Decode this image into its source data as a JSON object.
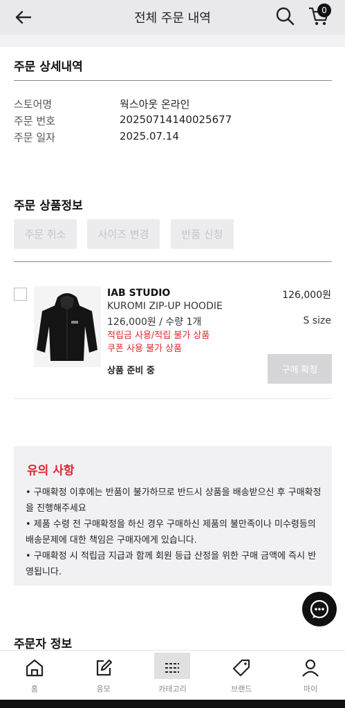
{
  "header": {
    "title": "전체 주문 내역",
    "cart_count": "0"
  },
  "order_detail": {
    "section_title": "주문 상세내역",
    "rows": [
      {
        "label": "스토어명",
        "value": "웍스아웃 온라인"
      },
      {
        "label": "주문 번호",
        "value": "20250714140025677"
      },
      {
        "label": "주문 일자",
        "value": "2025.07.14"
      }
    ]
  },
  "product_info": {
    "section_title": "주문 상품정보",
    "buttons": [
      "주문 취소",
      "사이즈 변경",
      "반품 신청"
    ],
    "item": {
      "brand": "IAB STUDIO",
      "name": "KUROMI ZIP-UP HOODIE",
      "price_qty": "126,000원 / 수량 1개",
      "note1": "적립금 사용/적립 불가 상품",
      "note2": "쿠폰 사용 불가 상품",
      "status": "상품 준비 중",
      "price": "126,000원",
      "size": "S size",
      "confirm_label": "구매 확정"
    }
  },
  "notice": {
    "title": "유의 사항",
    "items": [
      "• 구매확정 이후에는 반품이 불가하므로 반드시 상품을 배송받으신 후 구매확정을 진행해주세요",
      "• 제품 수령 전 구매확정을 하신 경우 구매하신 제품의 불만족이나 미수령등의 배송문제에 대한 책임은 구매자에게 있습니다.",
      "• 구매확정 시 적립금 지급과 함께 회원 등급 산정을 위한 구매 금액에 즉시 반영됩니다."
    ]
  },
  "orderer": {
    "section_title": "주문자 정보"
  },
  "bottom_nav": {
    "items": [
      {
        "label": "홈",
        "icon": "home-icon"
      },
      {
        "label": "응모",
        "icon": "edit-icon"
      },
      {
        "label": "카테고리",
        "icon": "category-icon"
      },
      {
        "label": "브랜드",
        "icon": "tag-icon"
      },
      {
        "label": "마이",
        "icon": "person-icon"
      }
    ]
  },
  "colors": {
    "accent_red": "#e0262d",
    "header_bg": "#e9e9ec"
  }
}
